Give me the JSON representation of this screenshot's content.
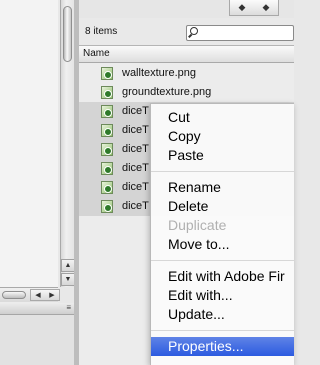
{
  "left_panel": {
    "scroll_up": "▲",
    "scroll_down": "▼",
    "h_scroll_left": "◀",
    "h_scroll_right": "▶",
    "menu_icon": "≡",
    "icons": {
      "menu": "panel-menu-icon"
    }
  },
  "asset_panel": {
    "dock_controls": [
      "◆",
      "◆"
    ],
    "items_count": "8 items",
    "search_placeholder": "",
    "column_header": "Name",
    "files": [
      {
        "name": "walltexture.png",
        "icon": "png-image-icon"
      },
      {
        "name": "groundtexture.png",
        "icon": "png-image-icon"
      },
      {
        "name": "diceT",
        "icon": "png-image-icon"
      },
      {
        "name": "diceT",
        "icon": "png-image-icon"
      },
      {
        "name": "diceT",
        "icon": "png-image-icon"
      },
      {
        "name": "diceT",
        "icon": "png-image-icon"
      },
      {
        "name": "diceT",
        "icon": "png-image-icon"
      },
      {
        "name": "diceT",
        "icon": "png-image-icon"
      }
    ]
  },
  "context_menu": {
    "items": [
      {
        "label": "Cut",
        "enabled": true
      },
      {
        "label": "Copy",
        "enabled": true
      },
      {
        "label": "Paste",
        "enabled": true
      },
      {
        "label": "Rename",
        "enabled": true
      },
      {
        "label": "Delete",
        "enabled": true
      },
      {
        "label": "Duplicate",
        "enabled": false
      },
      {
        "label": "Move to...",
        "enabled": true
      },
      {
        "label": "Edit with Adobe Fir",
        "enabled": true
      },
      {
        "label": "Edit with...",
        "enabled": true
      },
      {
        "label": "Update...",
        "enabled": true
      },
      {
        "label": "Properties...",
        "enabled": true,
        "highlighted": true
      }
    ]
  },
  "colors": {
    "menu_highlight": "#3b68e3",
    "disabled_text": "#b0b0b0",
    "selected_row": "#d4d4d4"
  }
}
